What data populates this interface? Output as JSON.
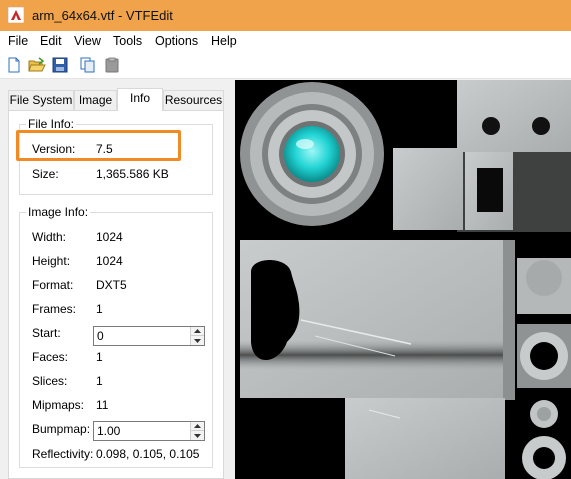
{
  "window": {
    "title": "arm_64x64.vtf - VTFEdit",
    "titlebar_color": "#f0a34a"
  },
  "menu": [
    "File",
    "Edit",
    "View",
    "Tools",
    "Options",
    "Help"
  ],
  "toolbar": {
    "buttons": [
      "new-icon",
      "open-icon",
      "save-icon",
      "copy-icon",
      "paste-icon"
    ]
  },
  "tabs": [
    "File System",
    "Image",
    "Info",
    "Resources"
  ],
  "active_tab": "Info",
  "file_info": {
    "legend": "File Info:",
    "version_label": "Version:",
    "version_value": "7.5",
    "size_label": "Size:",
    "size_value": "1,365.586 KB"
  },
  "image_info": {
    "legend": "Image Info:",
    "width_label": "Width:",
    "width_value": "1024",
    "height_label": "Height:",
    "height_value": "1024",
    "format_label": "Format:",
    "format_value": "DXT5",
    "frames_label": "Frames:",
    "frames_value": "1",
    "start_label": "Start:",
    "start_value": "0",
    "faces_label": "Faces:",
    "faces_value": "1",
    "slices_label": "Slices:",
    "slices_value": "1",
    "mipmaps_label": "Mipmaps:",
    "mipmaps_value": "11",
    "bumpmap_label": "Bumpmap:",
    "bumpmap_value": "1.00",
    "reflectivity_label": "Reflectivity:",
    "reflectivity_value": "0.098, 0.105, 0.105"
  },
  "highlight_color": "#f08a24"
}
